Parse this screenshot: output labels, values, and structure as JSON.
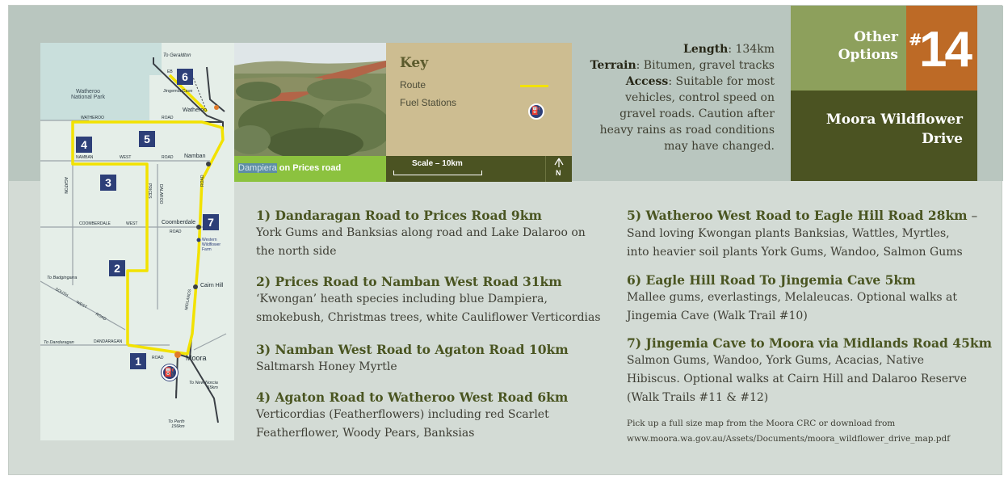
{
  "header": {
    "other_options": [
      "Other",
      "Options"
    ],
    "number_hash": "#",
    "number": "14",
    "drive_title": [
      "Moora Wildflower",
      "Drive"
    ]
  },
  "info": {
    "length_label": "Length",
    "length_value": ": 134km",
    "terrain_label": "Terrain",
    "terrain_value": ": Bitumen, gravel tracks",
    "access_label": "Access",
    "access_value": ": Suitable for most",
    "access_lines": [
      "vehicles, control speed on",
      "gravel roads. Caution after",
      "heavy rains as road conditions",
      "may have changed."
    ]
  },
  "photo": {
    "caption_highlight": "Dampiera",
    "caption_rest": " on Prices road"
  },
  "key": {
    "title": "Key",
    "route": "Route",
    "fuel": "Fuel Stations",
    "scale": "Scale – 10km",
    "north": "N"
  },
  "colors": {
    "route": "#f2e200",
    "badge": "#2d3f78",
    "green_caption": "#8cc23f",
    "olive_dark": "#4b5322",
    "orange": "#bd6a26",
    "options_green": "#8da05c"
  },
  "map": {
    "labels": {
      "geraldton": "To Geraldton",
      "jingemia": "Jingemia Cave",
      "eneabba": "EB",
      "national_park": [
        "Watheroo",
        "National Park"
      ],
      "watheroo": "Watheroo",
      "watheroo_road_a": "WATHEROO",
      "watheroo_road_b": "ROAD",
      "namban_road_a": "NAMBAN",
      "namban_road_b": "WEST",
      "namban_road_c": "ROAD",
      "namban": "Namban",
      "agaton": "AGATON",
      "prices": "PRICES",
      "dalaroo": "DALAROO",
      "coomberdale_road_a": "COOMBERDALE",
      "coomberdale_road_b": "WEST",
      "coomberdale_road_c": "ROAD",
      "coomberdale": "Coomberdale",
      "road_v": "ROAD",
      "western_wildflower_farm": [
        "Western",
        "Wildflower",
        "Farm"
      ],
      "cairn_hill": "Cairn Hill",
      "badgingarra": "To Badgingarra",
      "south_west": "SOUTH",
      "south_west_b": "WEST",
      "south_west_c": "ROAD",
      "midlands": "MIDLANDS",
      "dandaragan_to": "To Dandaragan",
      "dandaragan_road": "DANDARAGAN",
      "road_small": "ROAD",
      "moora": "Moora",
      "new_norcia": [
        "To New Norcia",
        "55km"
      ],
      "perth": [
        "To Perth",
        "156km"
      ],
      "fuel_glyph": "⛽"
    },
    "badges": [
      "1",
      "2",
      "3",
      "4",
      "5",
      "6",
      "7"
    ]
  },
  "sections": [
    {
      "title": "1) Dandaragan Road to Prices Road 9km",
      "lines": [
        "York Gums and Banksias along road and Lake Dalaroo on",
        "the north side"
      ]
    },
    {
      "title": "2) Prices Road to Namban West Road 31km",
      "lines": [
        "‘Kwongan’ heath species including blue Dampiera,",
        "smokebush, Christmas trees, white Cauliflower Verticordias"
      ]
    },
    {
      "title": "3) Namban West Road to Agaton Road 10km",
      "lines": [
        "Saltmarsh Honey Myrtle"
      ]
    },
    {
      "title": "4) Agaton Road to Watheroo West Road 6km",
      "lines": [
        "Verticordias (Featherflowers) including red Scarlet",
        "Featherflower, Woody Pears, Banksias"
      ]
    },
    {
      "title": "5) Watheroo West Road to Eagle Hill Road 28km",
      "dash": " –",
      "lines": [
        "Sand loving Kwongan plants Banksias, Wattles, Myrtles,",
        "into heavier soil plants York Gums, Wandoo, Salmon Gums"
      ]
    },
    {
      "title": "6) Eagle Hill Road To Jingemia Cave 5km",
      "lines": [
        "Mallee gums, everlastings, Melaleucas. Optional walks at",
        "Jingemia Cave (Walk Trail #10)"
      ]
    },
    {
      "title": "7) Jingemia Cave to Moora via Midlands Road 45km",
      "lines": [
        "Salmon Gums, Wandoo, York Gums, Acacias, Native",
        "Hibiscus. Optional walks at Cairn Hill and Dalaroo Reserve",
        "(Walk Trails #11 & #12)"
      ]
    }
  ],
  "footer": [
    "Pick up a full size map from the Moora CRC or download from",
    "www.moora.wa.gov.au/Assets/Documents/moora_wildflower_drive_map.pdf"
  ]
}
